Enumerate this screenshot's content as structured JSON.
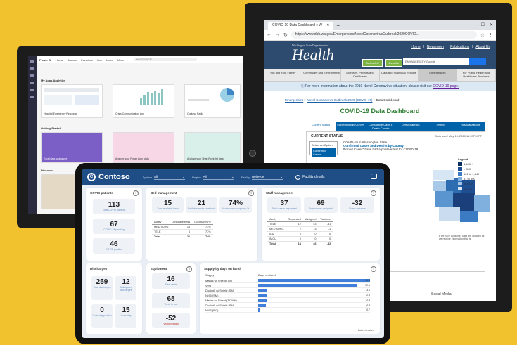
{
  "browser": {
    "tab_title": "COVID-19 Data Dashboard :: W",
    "url": "https://www.doh.wa.gov/Emergencies/NovelCoronavirusOutbreak2020COVID..."
  },
  "doh": {
    "logo_small": "Washington State Department of",
    "logo_big": "Health",
    "top_links": [
      "Home",
      "Newsroom",
      "Publications",
      "About Us"
    ],
    "btn_az": "Topics A-Z",
    "btn_es": "Español",
    "search_placeholder": "ENHANCED BY Google",
    "nav": [
      "You and Your Family",
      "Community and Environment",
      "Licenses, Permits and Certificates",
      "Data and Statistical Reports",
      "Emergencies",
      "For Public Health and Healthcare Providers"
    ],
    "alert_text": "For more information about the 2019 Novel Coronavirus situation, please visit our",
    "alert_link": "COVID-19 page.",
    "crumb1": "Emergencies",
    "crumb2": "Novel Coronavirus Outbreak 2020 (COVID-19)",
    "crumb3": "Data Dashboard",
    "title": "COVID-19 Data Dashboard",
    "dash_tabs": [
      "Current Status",
      "Epidemiologic Curves",
      "Cumulative Case & Death Counts",
      "Demographics",
      "Testing",
      "Hospitalizations"
    ],
    "current_status": "CURRENT STATUS",
    "as_of": "Data as of May 13, 2020 11:59PM PT",
    "select_option": "Select an Option",
    "confirmed_cases_btn": "Confirmed Cases",
    "wa_line1": "COVID-19 in Washington State",
    "wa_line2": "Confirmed Cases and Deaths by County",
    "wa_line3": "ffirmed Cases\" have had a positive test for COVID-19.",
    "legend_title": "Legend",
    "legend_items": [
      "1,440 +",
      "> 300",
      "101 to 1,440",
      "51 to 100",
      "11 to 50",
      "1 to 10"
    ],
    "note": "e we have available. Data are updated as we receive information that is",
    "social": "Social Media"
  },
  "powerbi_back": {
    "app_name": "Power BI",
    "top_menu": [
      "Home",
      "Browse",
      "Favorites",
      "Hub",
      "Learn",
      "More"
    ],
    "search": "Search Power BI",
    "section1": "My Apps Analytics",
    "cards1": [
      "Hospital Emergency Response",
      "Crisis Communication App",
      "Contoso Radio"
    ],
    "section2": "Getting Started",
    "cards2": [
      "Excel data to analyze",
      "Analyze your Power Apps data",
      "Analyze your SharePoint list data"
    ],
    "section3": "Discover"
  },
  "report": {
    "brand": "Contoso",
    "filters": [
      {
        "label": "System",
        "value": "All"
      },
      {
        "label": "Region",
        "value": "All"
      },
      {
        "label": "Facility",
        "value": "Bellevue"
      }
    ],
    "facility_details": "Facility details",
    "covid": {
      "title": "COVID patients",
      "kpis": [
        {
          "value": "113",
          "caption": "Total COVID patients"
        },
        {
          "value": "67",
          "caption": "COVID 19 pending"
        },
        {
          "value": "46",
          "caption": "COVID positive"
        }
      ]
    },
    "beds": {
      "title": "Bed management",
      "kpis": [
        {
          "value": "15",
          "caption": "Total available beds"
        },
        {
          "value": "21",
          "caption": "Available acute care beds"
        },
        {
          "value": "74%",
          "caption": "Acute care occupancy %"
        }
      ],
      "headers": [
        "Acuity",
        "Available beds",
        "Occupancy %"
      ],
      "rows": [
        [
          "MED SURG",
          "15",
          "71%"
        ],
        [
          "TELE",
          "6",
          "77%"
        ]
      ],
      "total": [
        "Total",
        "21",
        "74%"
      ]
    },
    "staff": {
      "title": "Staff management",
      "kpis": [
        {
          "value": "37",
          "caption": "Total nurses requested"
        },
        {
          "value": "69",
          "caption": "Total nurses assigned"
        },
        {
          "value": "-32",
          "caption": "Nurse variance"
        }
      ],
      "headers": [
        "Acuity",
        "Requested",
        "Assigned",
        "Variance"
      ],
      "rows": [
        [
          "TELE",
          "12",
          "43",
          "-31"
        ],
        [
          "MED SURG",
          "2",
          "3",
          "-1"
        ],
        [
          "ICU",
          "0",
          "0",
          "0"
        ],
        [
          "IMCU",
          "0",
          "0",
          "0"
        ]
      ],
      "total": [
        "Total",
        "14",
        "46",
        "-32"
      ]
    },
    "discharges": {
      "title": "Discharges",
      "kpis": [
        {
          "value": "259",
          "caption": "Total discharges"
        },
        {
          "value": "12",
          "caption": "Anticipated discharges"
        },
        {
          "value": "0",
          "caption": "Yesterday positive"
        },
        {
          "value": "15",
          "caption": "Yesterday"
        }
      ]
    },
    "equipment": {
      "title": "Equipment",
      "kpis": [
        {
          "value": "16",
          "caption": "Total vents"
        },
        {
          "value": "68",
          "caption": "Vents in use"
        },
        {
          "value": "-52",
          "caption": "Vents needed"
        }
      ]
    },
    "supply": {
      "title": "Supply by days on hand",
      "col1": "Supply",
      "col2": "Days on hand",
      "rows": [
        {
          "name": "Masks w/ Shield (TX)",
          "value": 36.8
        },
        {
          "name": "Vent",
          "value": 32.6
        },
        {
          "name": "Duckbill w/ Shield (SM)",
          "value": 3.0
        },
        {
          "name": "N-95 (SM)",
          "value": 2.8
        },
        {
          "name": "Masks w/ Shield (TC/YN)",
          "value": 2.8
        },
        {
          "name": "Duckbill w/ Shield (SM)",
          "value": 2.5
        },
        {
          "name": "N-95 (RG)",
          "value": 0.7
        }
      ],
      "labels": [
        "36.8",
        "32.6",
        "3.0",
        "2.8",
        "2.8",
        "2.5",
        "0.7"
      ]
    },
    "updated": "Data refreshed"
  },
  "colors": {
    "background": "#f2c12e",
    "pbi_header": "#1f4d86",
    "bar": "#3f7fd9"
  }
}
